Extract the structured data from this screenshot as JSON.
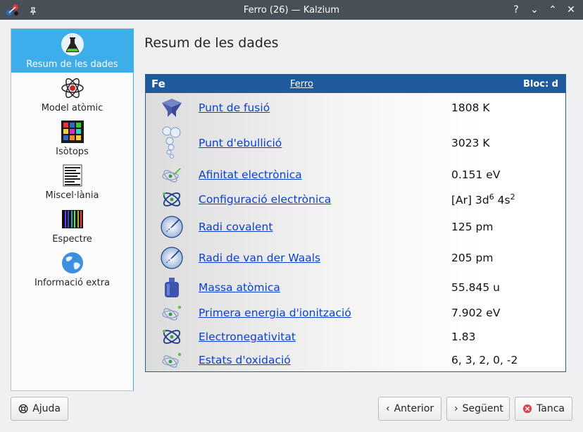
{
  "window": {
    "title": "Ferro (26) — Kalzium"
  },
  "titlebar_buttons": [
    "?",
    "⌄",
    "⌃",
    "✕"
  ],
  "sidebar": {
    "items": [
      {
        "label": "Resum de les dades",
        "icon": "flask-icon"
      },
      {
        "label": "Model atòmic",
        "icon": "atom-icon"
      },
      {
        "label": "Isòtops",
        "icon": "isotopes-icon"
      },
      {
        "label": "Miscel·lània",
        "icon": "misc-icon"
      },
      {
        "label": "Espectre",
        "icon": "spectrum-icon"
      },
      {
        "label": "Informació extra",
        "icon": "globe-icon"
      }
    ]
  },
  "page": {
    "title": "Resum de les dades"
  },
  "panel": {
    "symbol": "Fe",
    "name": "Ferro",
    "block": "Bloc: d",
    "rows": [
      {
        "label": "Punt de fusió",
        "value": "1808 K",
        "icon": "melting-point-icon"
      },
      {
        "label": "Punt d'ebullició",
        "value": "3023 K",
        "icon": "boiling-point-icon"
      },
      {
        "label": "Afinitat electrònica",
        "value": "0.151 eV",
        "icon": "electron-affinity-icon"
      },
      {
        "label": "Configuració electrònica",
        "value": "",
        "icon": "electron-config-icon"
      },
      {
        "label": "Radi covalent",
        "value": "125 pm",
        "icon": "covalent-radius-icon"
      },
      {
        "label": "Radi de van der Waals",
        "value": "205 pm",
        "icon": "vdw-radius-icon"
      },
      {
        "label": "Massa atòmica",
        "value": "55.845 u",
        "icon": "atomic-mass-icon"
      },
      {
        "label": "Primera energia d'ionització",
        "value": "7.902 eV",
        "icon": "ionization-energy-icon"
      },
      {
        "label": "Electronegativitat",
        "value": "1.83",
        "icon": "electronegativity-icon"
      },
      {
        "label": "Estats d'oxidació",
        "value": "6, 3, 2, 0, -2",
        "icon": "oxidation-states-icon"
      }
    ],
    "config": {
      "base": "[Ar] 3d",
      "sup1": "6",
      "mid": " 4s",
      "sup2": "2"
    }
  },
  "buttons": {
    "help": "Ajuda",
    "previous": "Anterior",
    "next": "Següent",
    "close": "Tanca"
  }
}
